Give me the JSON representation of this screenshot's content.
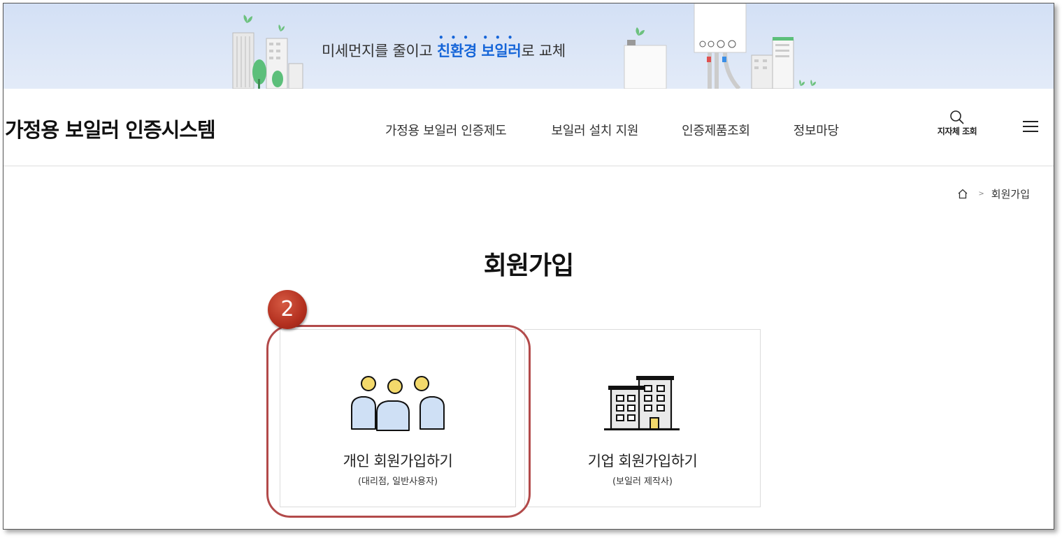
{
  "banner": {
    "text_before": "미세먼지를 줄이고 ",
    "highlight1": "친환경",
    "highlight2": "보일러",
    "text_after": "로 교체"
  },
  "header": {
    "logo": "가정용 보일러 인증시스템",
    "nav": [
      "가정용 보일러 인증제도",
      "보일러 설치 지원",
      "인증제품조회",
      "정보마당"
    ],
    "search_label": "지자체 조회"
  },
  "breadcrumb": {
    "current": "회원가입"
  },
  "page": {
    "title": "회원가입",
    "step": "2"
  },
  "cards": {
    "personal": {
      "title": "개인 회원가입하기",
      "subtitle": "(대리점, 일반사용자)"
    },
    "company": {
      "title": "기업 회원가입하기",
      "subtitle": "(보일러 제작사)"
    }
  },
  "colors": {
    "accent": "#1565d8",
    "annotation": "#b24a4a",
    "person_icon_fill": "#cfe0f5",
    "person_head_fill": "#f3d96b"
  }
}
